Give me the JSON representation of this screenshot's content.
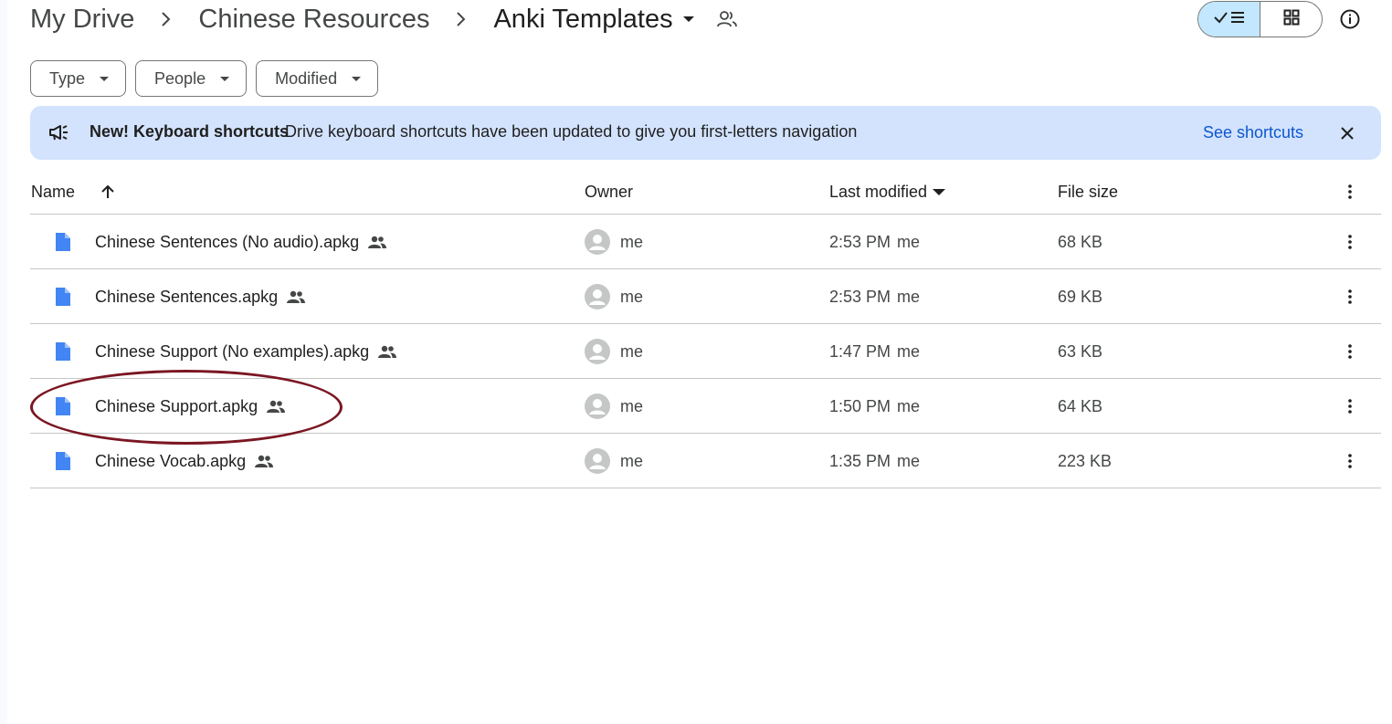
{
  "breadcrumb": {
    "items": [
      "My Drive",
      "Chinese Resources",
      "Anki Templates"
    ]
  },
  "filters": [
    {
      "label": "Type"
    },
    {
      "label": "People"
    },
    {
      "label": "Modified"
    }
  ],
  "banner": {
    "title": "New! Keyboard shortcuts",
    "message": "Drive keyboard shortcuts have been updated to give you first-letters navigation",
    "link": "See shortcuts"
  },
  "table": {
    "columns": {
      "name": "Name",
      "owner": "Owner",
      "last_modified": "Last modified",
      "file_size": "File size"
    },
    "rows": [
      {
        "name": "Chinese Sentences (No audio).apkg",
        "owner": "me",
        "time": "2:53 PM",
        "by": "me",
        "size": "68 KB"
      },
      {
        "name": "Chinese Sentences.apkg",
        "owner": "me",
        "time": "2:53 PM",
        "by": "me",
        "size": "69 KB"
      },
      {
        "name": "Chinese Support (No examples).apkg",
        "owner": "me",
        "time": "1:47 PM",
        "by": "me",
        "size": "63 KB"
      },
      {
        "name": "Chinese Support.apkg",
        "owner": "me",
        "time": "1:50 PM",
        "by": "me",
        "size": "64 KB"
      },
      {
        "name": "Chinese Vocab.apkg",
        "owner": "me",
        "time": "1:35 PM",
        "by": "me",
        "size": "223 KB"
      }
    ]
  },
  "colors": {
    "banner_bg": "#d3e3fd",
    "link": "#0b57d0",
    "file_icon": "#4285f4",
    "view_toggle_active": "#c2e7ff",
    "annotation_ring": "#7b1622"
  },
  "icons": {
    "breadcrumb_separator": "chevron-right-icon",
    "folder_menu": "caret-down-icon",
    "folder_shared": "people-outline-icon",
    "list_view": "check-list-icon",
    "grid_view": "grid-icon",
    "details": "info-icon",
    "banner": "megaphone-icon",
    "banner_close": "close-icon",
    "sort": "arrow-up-icon",
    "file": "file-doc-icon",
    "shared": "people-icon",
    "owner": "avatar-icon",
    "more": "more-vert-icon"
  },
  "highlighted_row": "Chinese Support.apkg"
}
